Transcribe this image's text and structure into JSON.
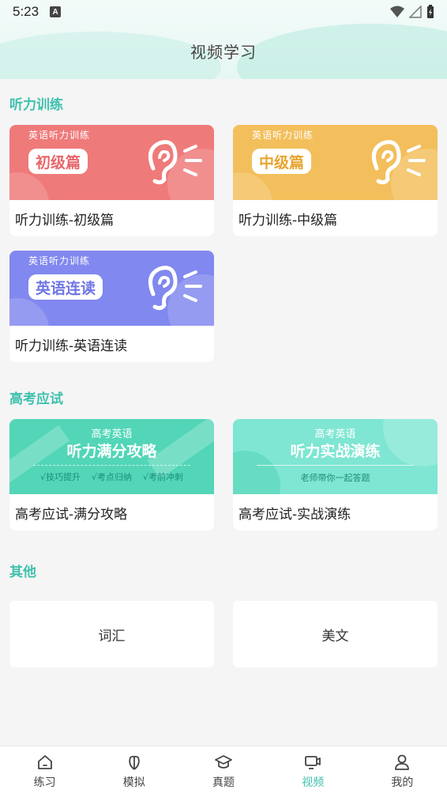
{
  "status": {
    "time": "5:23",
    "notification_glyph": "A"
  },
  "header": {
    "title": "视频学习"
  },
  "sections": [
    {
      "title": "听力训练",
      "cards": [
        {
          "banner_sub": "英语听力训练",
          "banner_title": "初级篇",
          "label": "听力训练-初级篇",
          "color": "#ef7a7a"
        },
        {
          "banner_sub": "英语听力训练",
          "banner_title": "中级篇",
          "label": "听力训练-中级篇",
          "color": "#f3bf5c"
        },
        {
          "banner_sub": "英语听力训练",
          "banner_title": "英语连读",
          "label": "听力训练-英语连读",
          "color": "#8188ef"
        }
      ]
    },
    {
      "title": "高考应试",
      "cards": [
        {
          "banner_sub": "高考英语",
          "banner_title": "听力满分攻略",
          "banner_points": [
            "√技巧提升",
            "√考点归纳",
            "√考前冲刺"
          ],
          "label": "高考应试-满分攻略",
          "color": "#52d6b7"
        },
        {
          "banner_sub": "高考英语",
          "banner_title": "听力实战演练",
          "banner_note": "老师带你一起答题",
          "label": "高考应试-实战演练",
          "color": "#7ee6d2"
        }
      ]
    },
    {
      "title": "其他",
      "cards": [
        {
          "label": "词汇"
        },
        {
          "label": "美文"
        }
      ]
    }
  ],
  "tabbar": {
    "items": [
      {
        "label": "练习",
        "icon": "home-icon"
      },
      {
        "label": "模拟",
        "icon": "leaf-icon"
      },
      {
        "label": "真题",
        "icon": "graduation-cap-icon"
      },
      {
        "label": "视频",
        "icon": "video-icon",
        "active": true
      },
      {
        "label": "我的",
        "icon": "user-icon"
      }
    ]
  },
  "colors": {
    "accent": "#3fc0ad"
  }
}
